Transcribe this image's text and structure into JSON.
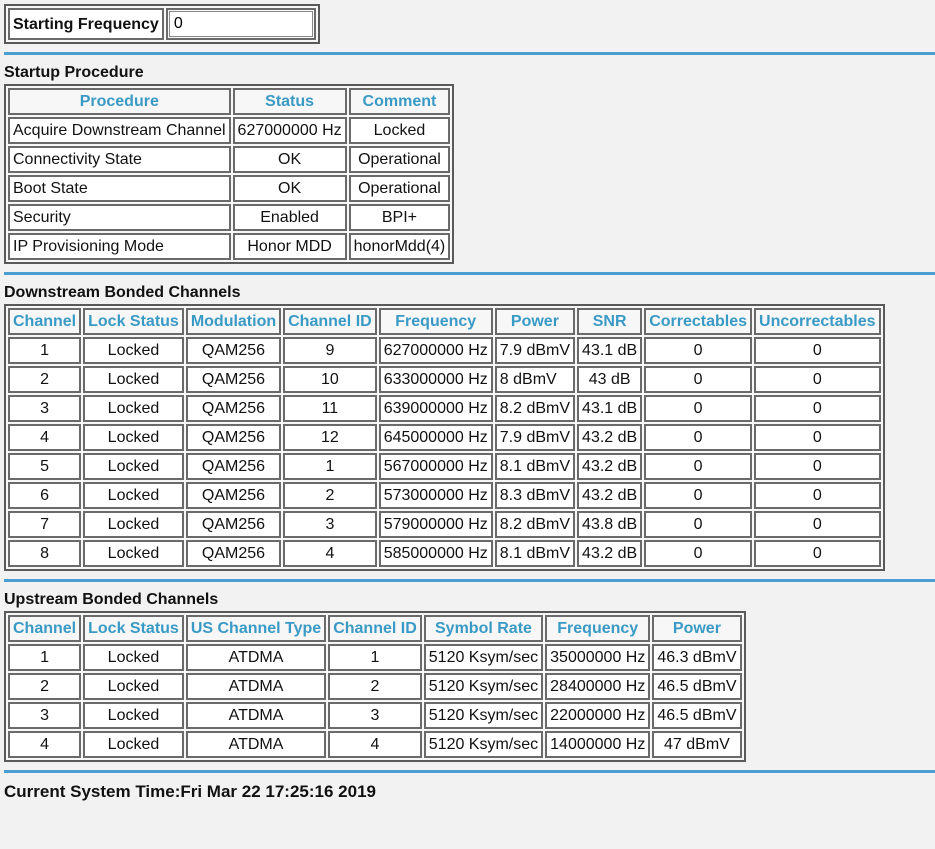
{
  "starting_frequency": {
    "label": "Starting Frequency",
    "value": "0"
  },
  "startup": {
    "title": "Startup Procedure",
    "headers": [
      "Procedure",
      "Status",
      "Comment"
    ],
    "rows": [
      [
        "Acquire Downstream Channel",
        "627000000 Hz",
        "Locked"
      ],
      [
        "Connectivity State",
        "OK",
        "Operational"
      ],
      [
        "Boot State",
        "OK",
        "Operational"
      ],
      [
        "Security",
        "Enabled",
        "BPI+"
      ],
      [
        "IP Provisioning Mode",
        "Honor MDD",
        "honorMdd(4)"
      ]
    ]
  },
  "downstream": {
    "title": "Downstream Bonded Channels",
    "headers": [
      "Channel",
      "Lock Status",
      "Modulation",
      "Channel ID",
      "Frequency",
      "Power",
      "SNR",
      "Correctables",
      "Uncorrectables"
    ],
    "rows": [
      [
        "1",
        "Locked",
        "QAM256",
        "9",
        "627000000 Hz",
        "7.9 dBmV",
        "43.1 dB",
        "0",
        "0"
      ],
      [
        "2",
        "Locked",
        "QAM256",
        "10",
        "633000000 Hz",
        "8 dBmV",
        "43 dB",
        "0",
        "0"
      ],
      [
        "3",
        "Locked",
        "QAM256",
        "11",
        "639000000 Hz",
        "8.2 dBmV",
        "43.1 dB",
        "0",
        "0"
      ],
      [
        "4",
        "Locked",
        "QAM256",
        "12",
        "645000000 Hz",
        "7.9 dBmV",
        "43.2 dB",
        "0",
        "0"
      ],
      [
        "5",
        "Locked",
        "QAM256",
        "1",
        "567000000 Hz",
        "8.1 dBmV",
        "43.2 dB",
        "0",
        "0"
      ],
      [
        "6",
        "Locked",
        "QAM256",
        "2",
        "573000000 Hz",
        "8.3 dBmV",
        "43.2 dB",
        "0",
        "0"
      ],
      [
        "7",
        "Locked",
        "QAM256",
        "3",
        "579000000 Hz",
        "8.2 dBmV",
        "43.8 dB",
        "0",
        "0"
      ],
      [
        "8",
        "Locked",
        "QAM256",
        "4",
        "585000000 Hz",
        "8.1 dBmV",
        "43.2 dB",
        "0",
        "0"
      ]
    ]
  },
  "upstream": {
    "title": "Upstream Bonded Channels",
    "headers": [
      "Channel",
      "Lock Status",
      "US Channel Type",
      "Channel ID",
      "Symbol Rate",
      "Frequency",
      "Power"
    ],
    "rows": [
      [
        "1",
        "Locked",
        "ATDMA",
        "1",
        "5120 Ksym/sec",
        "35000000 Hz",
        "46.3 dBmV"
      ],
      [
        "2",
        "Locked",
        "ATDMA",
        "2",
        "5120 Ksym/sec",
        "28400000 Hz",
        "46.5 dBmV"
      ],
      [
        "3",
        "Locked",
        "ATDMA",
        "3",
        "5120 Ksym/sec",
        "22000000 Hz",
        "46.5 dBmV"
      ],
      [
        "4",
        "Locked",
        "ATDMA",
        "4",
        "5120 Ksym/sec",
        "14000000 Hz",
        "47 dBmV"
      ]
    ]
  },
  "system_time": {
    "label": "Current System Time:",
    "value": "Fri Mar 22 17:25:16 2019"
  },
  "colors": {
    "header_text": "#3a9ac6",
    "separator": "#4b9fd0",
    "background": "#f2f2f2"
  }
}
